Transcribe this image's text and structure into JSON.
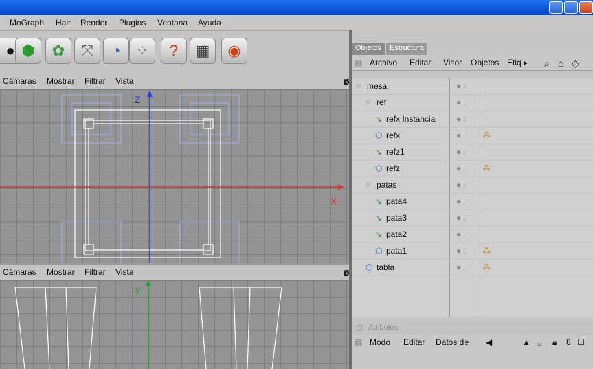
{
  "menubar": {
    "items": [
      "MoGraph",
      "Hair",
      "Render",
      "Plugins",
      "Ventana",
      "Ayuda"
    ]
  },
  "viewport_top": {
    "menu": [
      "Cámaras",
      "Mostrar",
      "Filtrar",
      "Vista"
    ],
    "axis_labels": {
      "z": "Z",
      "x": "X"
    }
  },
  "viewport_bottom": {
    "menu": [
      "Cámaras",
      "Mostrar",
      "Filtrar",
      "Vista"
    ],
    "axis_labels": {
      "y": "Y"
    }
  },
  "object_manager": {
    "tabs": [
      "Objetos",
      "Estructura"
    ],
    "menu": [
      "Archivo",
      "Editar",
      "Visor",
      "Objetos",
      "Etiq ▸"
    ],
    "objects": [
      {
        "name": "mesa",
        "icon": "null-object-icon",
        "tag": false
      },
      {
        "name": "ref",
        "icon": "null-object-icon",
        "tag": false
      },
      {
        "name": "refx Instancia",
        "icon": "instance-icon",
        "tag": false
      },
      {
        "name": "refx",
        "icon": "cube-object-icon",
        "tag": true
      },
      {
        "name": "refz1",
        "icon": "instance-icon",
        "tag": false
      },
      {
        "name": "refz",
        "icon": "cube-object-icon",
        "tag": true
      },
      {
        "name": "patas",
        "icon": "null-object-icon",
        "tag": false
      },
      {
        "name": "pata4",
        "icon": "instance-icon",
        "tag": false
      },
      {
        "name": "pata3",
        "icon": "instance-icon",
        "tag": false
      },
      {
        "name": "pata2",
        "icon": "instance-icon",
        "tag": false
      },
      {
        "name": "pata1",
        "icon": "cube-object-icon",
        "tag": true
      },
      {
        "name": "tabla",
        "icon": "cube-object-icon",
        "tag": true
      }
    ]
  },
  "attributes": {
    "title": "Atributos",
    "menu": [
      "Modo",
      "Editar",
      "Datos de"
    ]
  },
  "colors": {
    "axis_z": "#1f3fd8",
    "axis_x": "#e03030",
    "axis_y": "#22aa22",
    "titlebar": "#0b55d8",
    "tag": "#c57a18"
  }
}
